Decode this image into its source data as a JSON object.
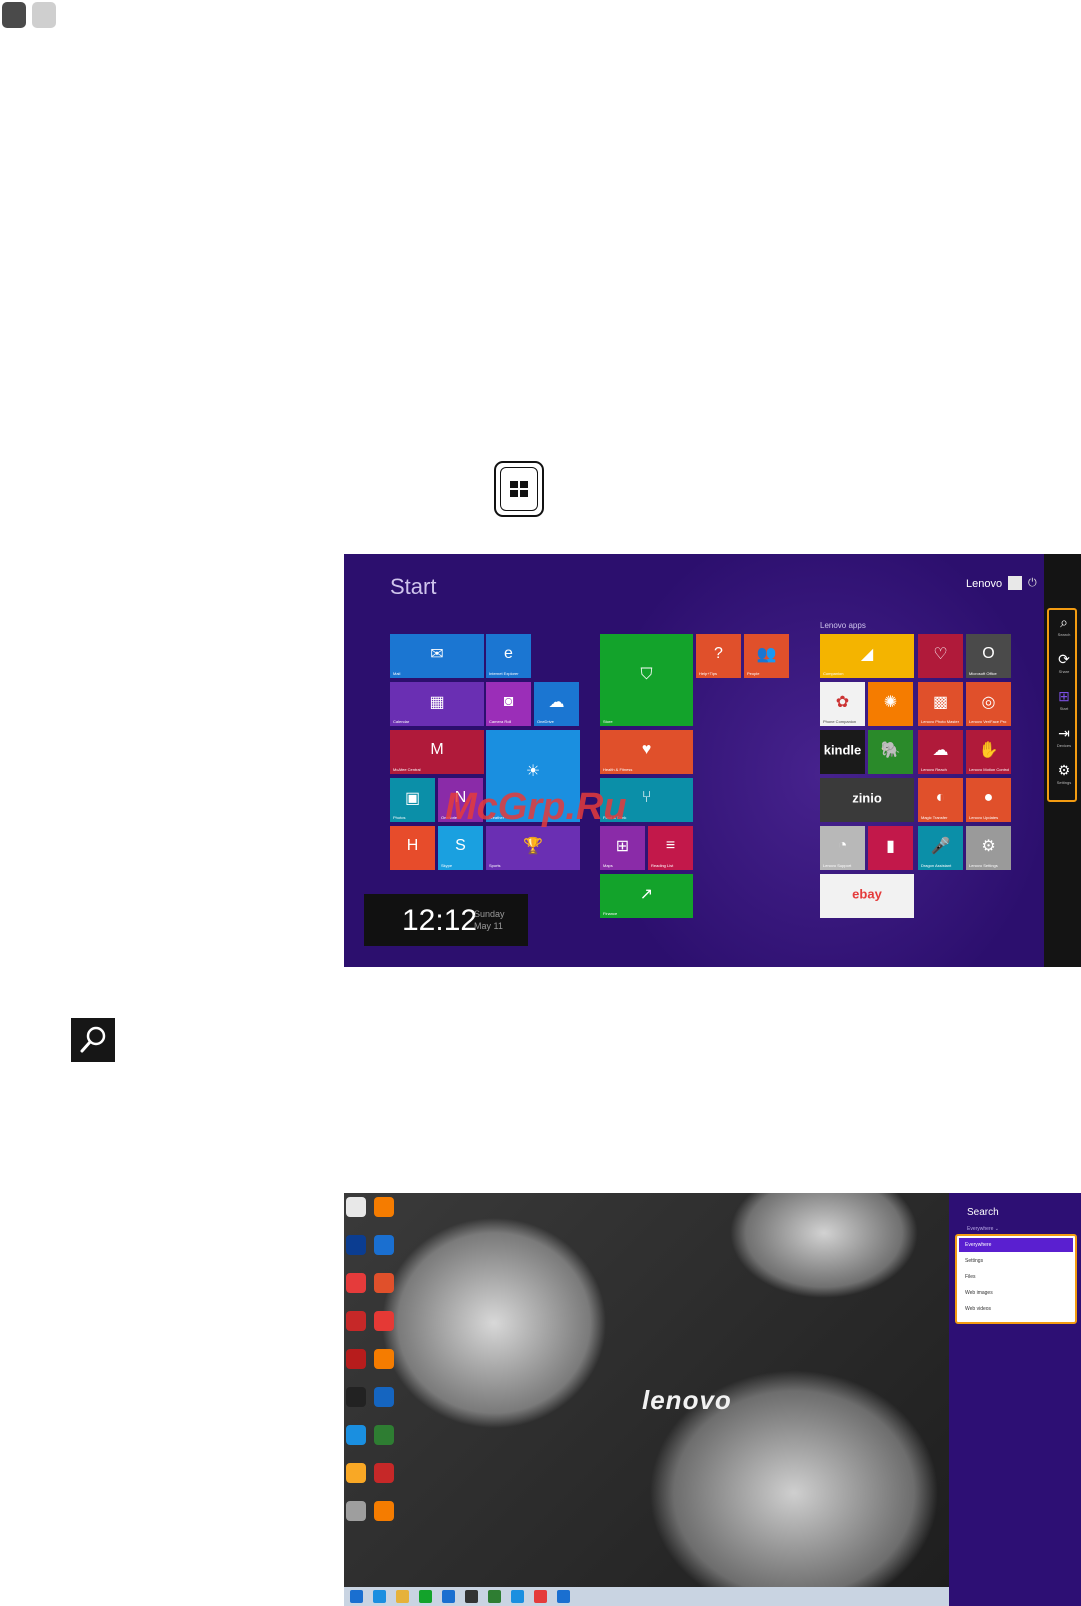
{
  "colors": {
    "start_bg": "#2c0f6e",
    "highlight": "#f39c12",
    "search_pane": "#2d0f74",
    "selected": "#5a1fd0"
  },
  "start_screen": {
    "title": "Start",
    "user": "Lenovo",
    "section_label": "Lenovo apps",
    "tiles": [
      {
        "label": "Mail",
        "color": "#1b76d2",
        "icon": "envelope-icon",
        "glyph": "✉"
      },
      {
        "label": "Internet Explorer",
        "color": "#1b76d2",
        "icon": "ie-icon",
        "glyph": "e"
      },
      {
        "label": "Calendar",
        "color": "#6a2fb3",
        "icon": "calendar-icon",
        "glyph": "▦"
      },
      {
        "label": "Camera Roll",
        "color": "#9b2eb8",
        "icon": "camera-icon",
        "glyph": "◙"
      },
      {
        "label": "OneDrive",
        "color": "#1b76d2",
        "icon": "cloud-icon",
        "glyph": "☁"
      },
      {
        "label": "McAfee Central",
        "color": "#b01a3a",
        "icon": "mcafee-icon",
        "glyph": "M"
      },
      {
        "label": "Weather",
        "color": "#1a8fe0",
        "icon": "sun-icon",
        "glyph": "☀"
      },
      {
        "label": "Photos",
        "color": "#0b8fa8",
        "icon": "photo-icon",
        "glyph": "▣"
      },
      {
        "label": "OneNote",
        "color": "#8a2ba8",
        "icon": "onenote-icon",
        "glyph": "N"
      },
      {
        "label": "",
        "color": "#e74c2b",
        "icon": "app-icon",
        "glyph": "H"
      },
      {
        "label": "Skype",
        "color": "#1aa0e0",
        "icon": "skype-icon",
        "glyph": "S"
      },
      {
        "label": "Sports",
        "color": "#6a2fb3",
        "icon": "trophy-icon",
        "glyph": "🏆"
      },
      {
        "label": "Store",
        "color": "#13a32b",
        "icon": "store-icon",
        "glyph": "⛉"
      },
      {
        "label": "Health & Fitness",
        "color": "#e0502b",
        "icon": "heart-icon",
        "glyph": "♥"
      },
      {
        "label": "Food & Drink",
        "color": "#0b8fa8",
        "icon": "food-icon",
        "glyph": "⑂"
      },
      {
        "label": "Maps",
        "color": "#8a2ba8",
        "icon": "map-icon",
        "glyph": "⊞"
      },
      {
        "label": "Reading List",
        "color": "#c2184a",
        "icon": "list-icon",
        "glyph": "≡"
      },
      {
        "label": "Finance",
        "color": "#13a32b",
        "icon": "chart-icon",
        "glyph": "↗"
      },
      {
        "label": "Help+Tips",
        "color": "#e0502b",
        "icon": "help-icon",
        "glyph": "?"
      },
      {
        "label": "People",
        "color": "#e0502b",
        "icon": "people-icon",
        "glyph": "👥"
      },
      {
        "label": "Companion",
        "color": "#f4b400",
        "icon": "companion-icon",
        "glyph": "◢"
      },
      {
        "label": "",
        "color": "#b01a3a",
        "icon": "heart-app-icon",
        "glyph": "♡"
      },
      {
        "label": "Microsoft Office",
        "color": "#4a4a4a",
        "icon": "office-icon",
        "glyph": "O"
      },
      {
        "label": "Phone Companion",
        "color": "#f2f2f2",
        "icon": "phone-icon",
        "glyph": "✿"
      },
      {
        "label": "",
        "color": "#f57c00",
        "icon": "sun-app-icon",
        "glyph": "✺"
      },
      {
        "label": "Lenovo Photo Master",
        "color": "#e0502b",
        "icon": "photo-master-icon",
        "glyph": "▩"
      },
      {
        "label": "Lenovo VeriFace Pro",
        "color": "#e0502b",
        "icon": "veriface-icon",
        "glyph": "◎"
      },
      {
        "label": "",
        "color": "#1a1a1a",
        "icon": "kindle-icon",
        "glyph": "kindle"
      },
      {
        "label": "",
        "color": "#2a8a2a",
        "icon": "evernote-icon",
        "glyph": "🐘"
      },
      {
        "label": "Lenovo Reach",
        "color": "#b01a3a",
        "icon": "reach-icon",
        "glyph": "☁"
      },
      {
        "label": "Lenovo Motion Control",
        "color": "#b01a3a",
        "icon": "motion-icon",
        "glyph": "✋"
      },
      {
        "label": "",
        "color": "#3a3a3a",
        "icon": "zinio-icon",
        "glyph": "zinio"
      },
      {
        "label": "Magic Transfer",
        "color": "#e0502b",
        "icon": "transfer-icon",
        "glyph": "◐"
      },
      {
        "label": "Lenovo Updates",
        "color": "#e0502b",
        "icon": "updates-icon",
        "glyph": "●"
      },
      {
        "label": "Lenovo Support",
        "color": "#b8b8b8",
        "icon": "support-icon",
        "glyph": "◔"
      },
      {
        "label": "",
        "color": "#c2184a",
        "icon": "film-icon",
        "glyph": "▮"
      },
      {
        "label": "Dragon Assistant",
        "color": "#0b8fa8",
        "icon": "dragon-icon",
        "glyph": "🎤"
      },
      {
        "label": "Lenovo Settings",
        "color": "#9a9a9a",
        "icon": "settings-app-icon",
        "glyph": "⚙"
      },
      {
        "label": "",
        "color": "#f2f2f2",
        "icon": "ebay-icon",
        "glyph": "ebay"
      }
    ],
    "charms": [
      {
        "label": "Search",
        "glyph": "⌕"
      },
      {
        "label": "Share",
        "glyph": "⟳"
      },
      {
        "label": "Start",
        "glyph": "⊞"
      },
      {
        "label": "Devices",
        "glyph": "⇥"
      },
      {
        "label": "Settings",
        "glyph": "⚙"
      }
    ],
    "clock": {
      "time": "12:12",
      "day": "Sunday",
      "date": "May 11"
    }
  },
  "watermark": "McGrp.Ru",
  "desktop": {
    "logo": "lenovo",
    "search_pane": {
      "title": "Search",
      "scope": "Everywhere ⌄",
      "options": [
        "Everywhere",
        "Settings",
        "Files",
        "Web images",
        "Web videos"
      ]
    }
  }
}
